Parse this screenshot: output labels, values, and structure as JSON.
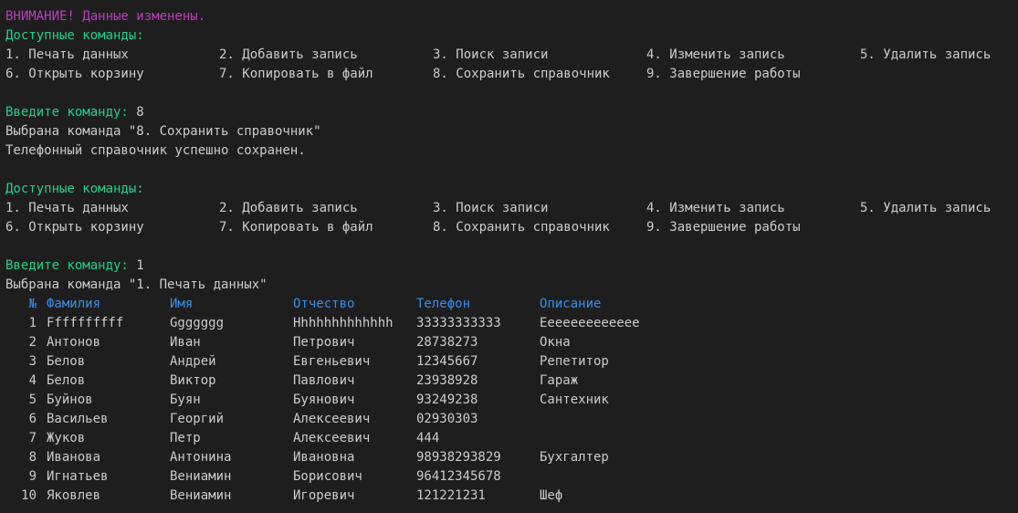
{
  "warning": "ВНИМАНИЕ! Данные изменены.",
  "available_label": "Доступные команды:",
  "commands": [
    "1. Печать данных",
    "2. Добавить запись",
    "3. Поиск записи",
    "4. Изменить запись",
    "5. Удалить запись",
    "6. Открыть корзину",
    "7. Копировать в файл",
    "8. Сохранить справочник",
    "9. Завершение работы"
  ],
  "prompt_label": "Введите команду:",
  "session1": {
    "input": "8",
    "selected": "Выбрана команда \"8. Сохранить справочник\"",
    "result": "Телефонный справочник успешно сохранен."
  },
  "session2": {
    "input": "1",
    "selected": "Выбрана команда \"1. Печать данных\""
  },
  "table": {
    "headers": [
      "№",
      "Фамилия",
      "Имя",
      "Отчество",
      "Телефон",
      "Описание"
    ],
    "rows": [
      [
        "1",
        "Ffffffffff",
        "Ggggggg",
        "Hhhhhhhhhhhhh",
        "33333333333",
        "Eeeeeeeeeeeee"
      ],
      [
        "2",
        "Антонов",
        "Иван",
        "Петрович",
        "28738273",
        "Окна"
      ],
      [
        "3",
        "Белов",
        "Андрей",
        "Евгеньевич",
        "12345667",
        "Репетитор"
      ],
      [
        "4",
        "Белов",
        "Виктор",
        "Павлович",
        "23938928",
        "Гараж"
      ],
      [
        "5",
        "Буйнов",
        "Буян",
        "Буянович",
        "93249238",
        "Сантехник"
      ],
      [
        "6",
        "Васильев",
        "Георгий",
        "Алексеевич",
        "02930303",
        ""
      ],
      [
        "7",
        "Жуков",
        "Петр",
        "Алексеевич",
        "444",
        ""
      ],
      [
        "8",
        "Иванова",
        "Антонина",
        "Ивановна",
        "98938293829",
        "Бухгалтер"
      ],
      [
        "9",
        "Игнатьев",
        "Вениамин",
        "Борисович",
        "96412345678",
        ""
      ],
      [
        "10",
        "Яковлев",
        "Вениамин",
        "Игоревич",
        "121221231",
        "Шеф"
      ]
    ]
  }
}
